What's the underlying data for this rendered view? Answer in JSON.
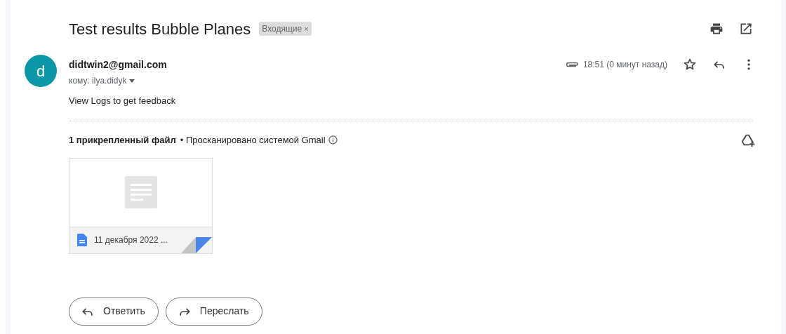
{
  "subject": "Test results Bubble Planes",
  "label": {
    "text": "Входящие",
    "remove": "×"
  },
  "message": {
    "avatar_letter": "d",
    "sender": "didtwin2@gmail.com",
    "recipient": "кому: ilya.didyk",
    "time": "18:51 (0 минут назад)",
    "starred": false,
    "body": "View Logs to get feedback"
  },
  "attachments": {
    "count_text": "1 прикрепленный файл",
    "scan_text": "• Просканировано системой Gmail",
    "files": [
      {
        "name": "11 декабря 2022 ..."
      }
    ]
  },
  "actions": [
    {
      "kind": "reply",
      "label": "Ответить"
    },
    {
      "kind": "forward",
      "label": "Переслать"
    }
  ]
}
